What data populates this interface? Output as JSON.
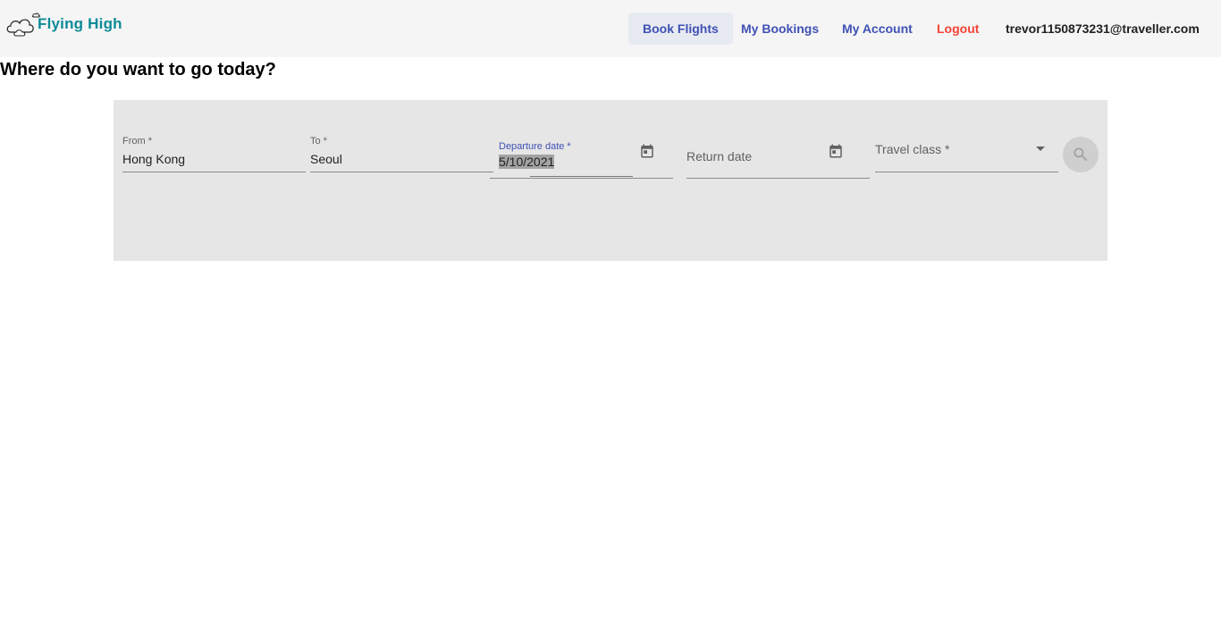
{
  "header": {
    "logo_text": "Flying High",
    "nav": {
      "book_flights": "Book Flights",
      "my_bookings": "My Bookings",
      "my_account": "My Account",
      "logout": "Logout"
    },
    "user_email": "trevor1150873231@traveller.com"
  },
  "main": {
    "title": "Where do you want to go today?",
    "form": {
      "from": {
        "label": "From *",
        "value": "Hong Kong"
      },
      "to": {
        "label": "To *",
        "value": "Seoul"
      },
      "departure": {
        "label": "Departure date *",
        "value": "5/10/2021"
      },
      "return": {
        "placeholder": "Return date",
        "value": ""
      },
      "travel_class": {
        "placeholder": "Travel class *",
        "value": ""
      }
    }
  },
  "colors": {
    "accent": "#3f51b5",
    "logout": "#f44336",
    "logo": "#0e8a97",
    "panel": "#e6e6e6"
  }
}
